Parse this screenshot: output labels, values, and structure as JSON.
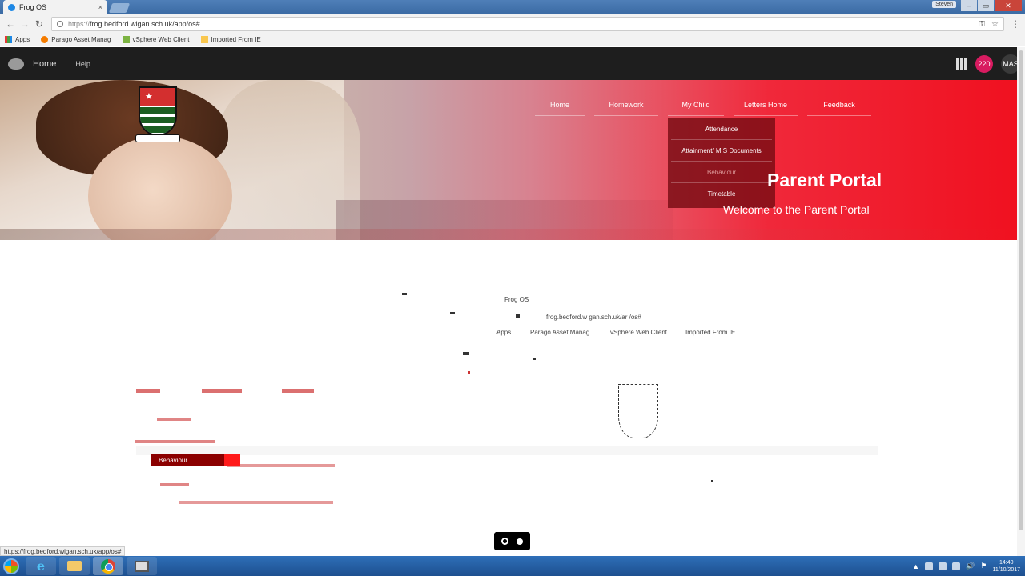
{
  "browser": {
    "tab_title": "Frog OS",
    "tab_close": "×",
    "user_label": "Steven",
    "window_buttons": [
      "–",
      "▭",
      "✕"
    ],
    "url_prefix": "https://",
    "url": "frog.bedford.wigan.sch.uk/app/os#",
    "bookmarks": [
      "Apps",
      "Parago Asset Manag",
      "vSphere Web Client",
      "Imported From IE"
    ]
  },
  "appbar": {
    "home": "Home",
    "help": "Help",
    "notifications": "220",
    "user_initials": "MAS"
  },
  "hero": {
    "nav": [
      "Home",
      "Homework",
      "My Child",
      "Letters Home",
      "Feedback"
    ],
    "dropdown": [
      "Attendance",
      "Attainment/ MIS Documents",
      "Behaviour",
      "Timetable"
    ],
    "title": "Parent Portal",
    "subtitle": "Welcome to the Parent Portal"
  },
  "artifacts": {
    "ghost_title": "Frog OS",
    "ghost_url": "frog.bedford.w gan.sch.uk/ar /os#",
    "ghost_bookmarks": [
      "Apps",
      "Parago Asset Manag",
      "vSphere Web Client",
      "Imported From IE"
    ],
    "ghost_behaviour": "Behaviour"
  },
  "statusbar": "https://frog.bedford.wigan.sch.uk/app/os#",
  "taskbar": {
    "time": "14:40",
    "date": "11/10/2017"
  }
}
